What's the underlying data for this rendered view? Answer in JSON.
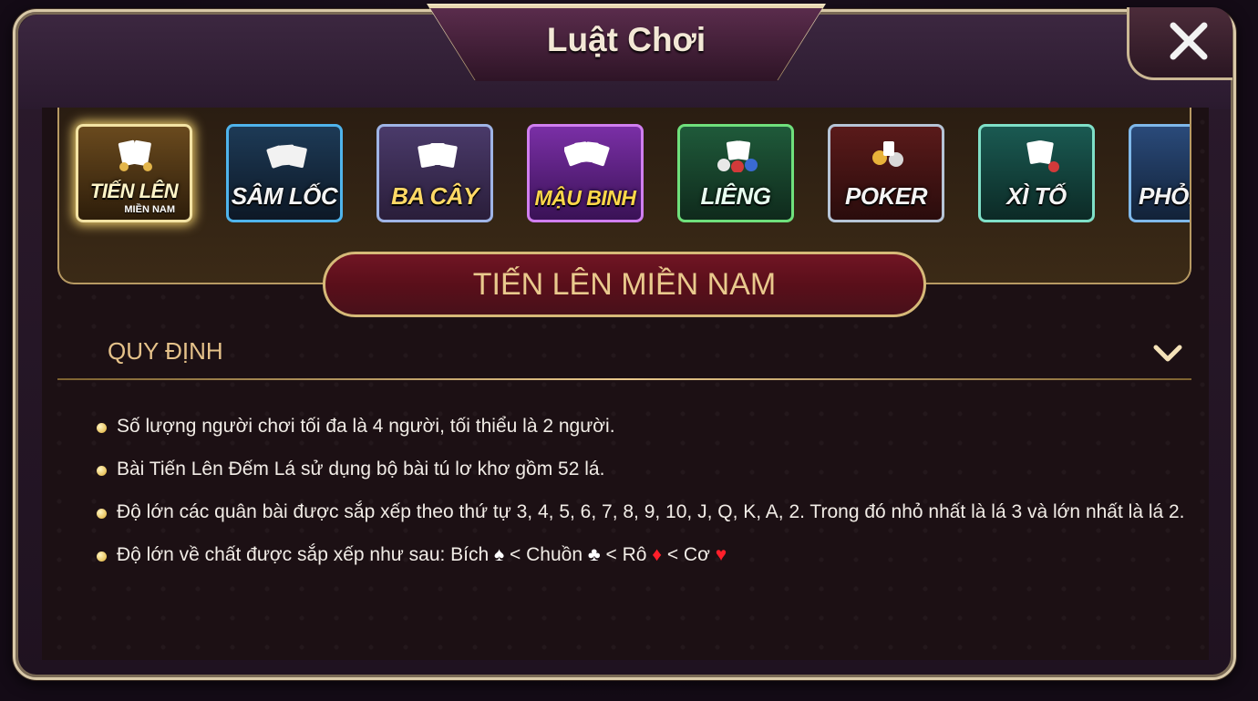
{
  "window": {
    "title": "Luật Chơi"
  },
  "tabs": [
    {
      "label": "TIẾN LÊN",
      "sublabel": "MIỀN NAM",
      "active": true,
      "color": "#f3e3a4"
    },
    {
      "label": "SÂM LỐC",
      "sublabel": "",
      "active": false,
      "color": "#63b6e6"
    },
    {
      "label": "BA CÂY",
      "sublabel": "",
      "active": false,
      "color": "#8fa8d8"
    },
    {
      "label": "MẬU BINH",
      "sublabel": "",
      "active": false,
      "color": "#c97be6"
    },
    {
      "label": "LIÊNG",
      "sublabel": "",
      "active": false,
      "color": "#7fe28a"
    },
    {
      "label": "POKER",
      "sublabel": "",
      "active": false,
      "color": "#b7c6d8"
    },
    {
      "label": "XÌ TỐ",
      "sublabel": "",
      "active": false,
      "color": "#7fe0c8"
    },
    {
      "label": "PHỎM",
      "sublabel": "",
      "active": false,
      "color": "#7fb8ea"
    }
  ],
  "game_title": "TIẾN LÊN MIỀN NAM",
  "section": {
    "title": "QUY ĐỊNH",
    "expanded": true
  },
  "rules": [
    "Số lượng người chơi tối đa là 4 người, tối thiểu là 2 người.",
    "Bài Tiến Lên Đếm Lá sử dụng bộ bài tú lơ khơ gồm 52 lá.",
    "Độ lớn các quân bài được sắp xếp theo thứ tự 3, 4, 5, 6, 7, 8, 9, 10, J, Q, K, A, 2. Trong đó nhỏ nhất là lá 3 và lớn nhất là lá 2."
  ],
  "suit_rule": {
    "prefix": "Độ lớn về chất được sắp xếp như sau: Bích ",
    "spade": "♠",
    "lt1": " < Chuồn ",
    "club": "♣",
    "lt2": " < Rô ",
    "diamond": "♦",
    "lt3": " < Cơ ",
    "heart": "♥"
  },
  "colors": {
    "gold": "#e5c28a",
    "pill": "#701524",
    "red_suit": "#ff1f2a"
  }
}
